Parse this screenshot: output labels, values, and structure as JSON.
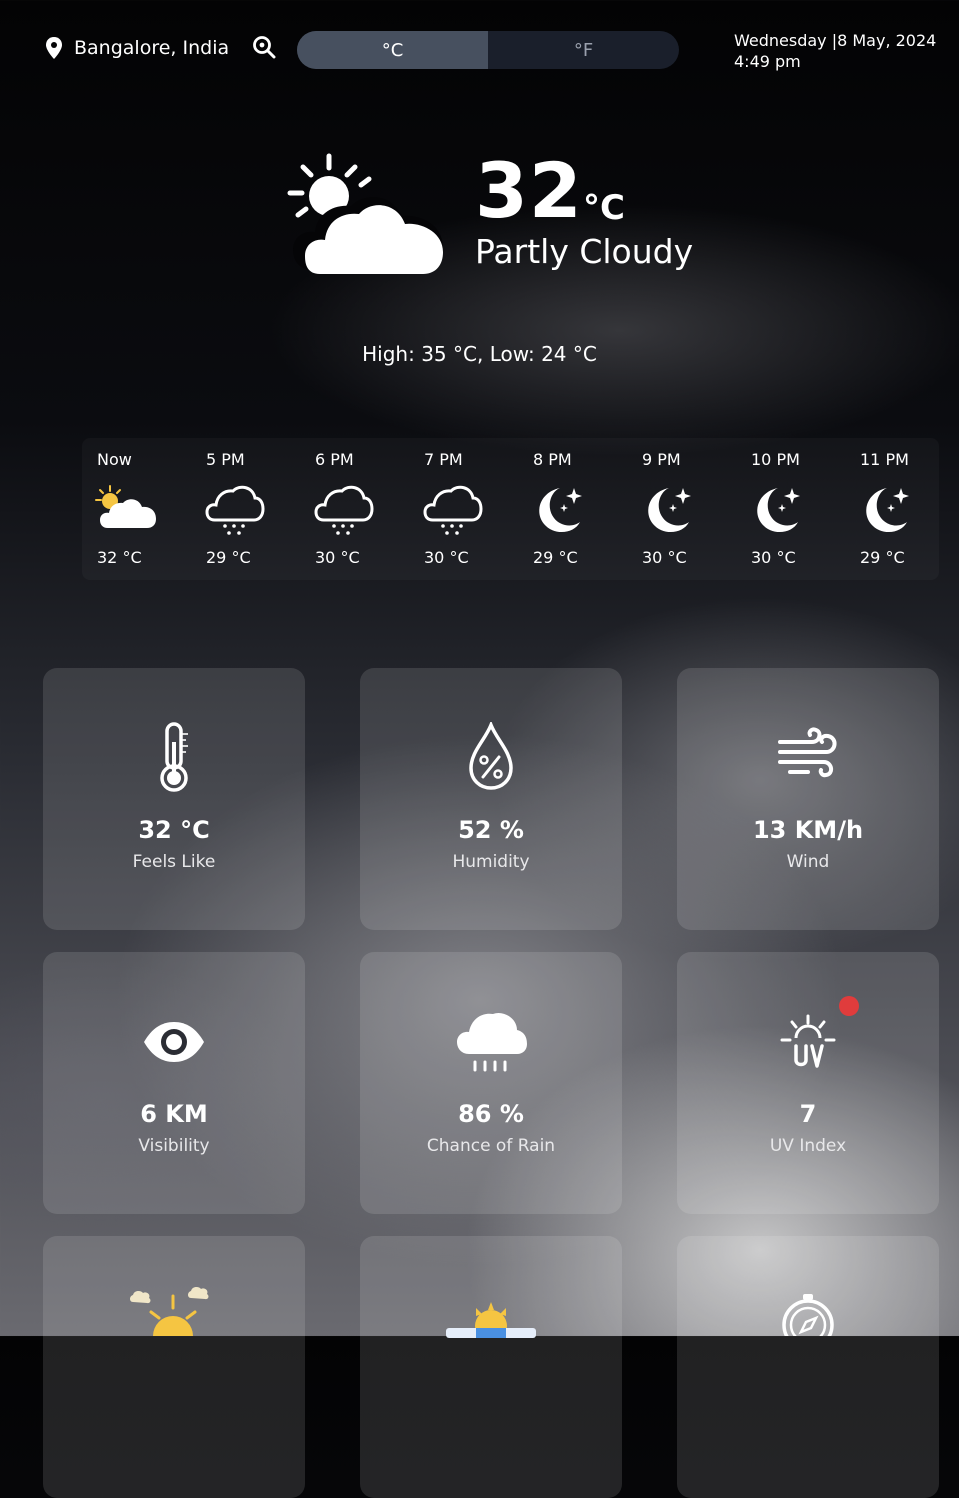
{
  "header": {
    "location": "Bangalore, India",
    "units": {
      "celsius": "°C",
      "fahrenheit": "°F",
      "selected": "°C"
    },
    "date": "Wednesday |8 May, 2024",
    "time": "4:49 pm"
  },
  "current": {
    "temperature": "32",
    "unit": "°C",
    "condition": "Partly Cloudy",
    "high_low": "High: 35 °C, Low: 24 °C",
    "icon": "partly-cloudy-icon"
  },
  "hourly": [
    {
      "time": "Now",
      "temp": "32 °C",
      "icon": "partly-cloudy-icon"
    },
    {
      "time": "5 PM",
      "temp": "29 °C",
      "icon": "snow-cloud-icon"
    },
    {
      "time": "6 PM",
      "temp": "30 °C",
      "icon": "snow-cloud-icon"
    },
    {
      "time": "7 PM",
      "temp": "30 °C",
      "icon": "snow-cloud-icon"
    },
    {
      "time": "8 PM",
      "temp": "29 °C",
      "icon": "moon-icon"
    },
    {
      "time": "9 PM",
      "temp": "30 °C",
      "icon": "moon-icon"
    },
    {
      "time": "10 PM",
      "temp": "30 °C",
      "icon": "moon-icon"
    },
    {
      "time": "11 PM",
      "temp": "29 °C",
      "icon": "moon-icon"
    }
  ],
  "details": {
    "feels_like": {
      "value": "32 °C",
      "label": "Feels Like",
      "icon": "thermometer-icon"
    },
    "humidity": {
      "value": "52 %",
      "label": "Humidity",
      "icon": "humidity-drop-icon"
    },
    "wind": {
      "value": "13 KM/h",
      "label": "Wind",
      "icon": "wind-icon"
    },
    "visibility": {
      "value": "6 KM",
      "label": "Visibility",
      "icon": "eye-icon"
    },
    "rain_chance": {
      "value": "86 %",
      "label": "Chance of Rain",
      "icon": "rain-cloud-icon"
    },
    "uv_index": {
      "value": "7",
      "label": "UV Index",
      "icon": "uv-icon"
    }
  },
  "colors": {
    "toggle_active": "#47505f",
    "toggle_track": "#1a1f2b",
    "uv_alert": "#e03c3c",
    "sun": "#f5c542"
  }
}
